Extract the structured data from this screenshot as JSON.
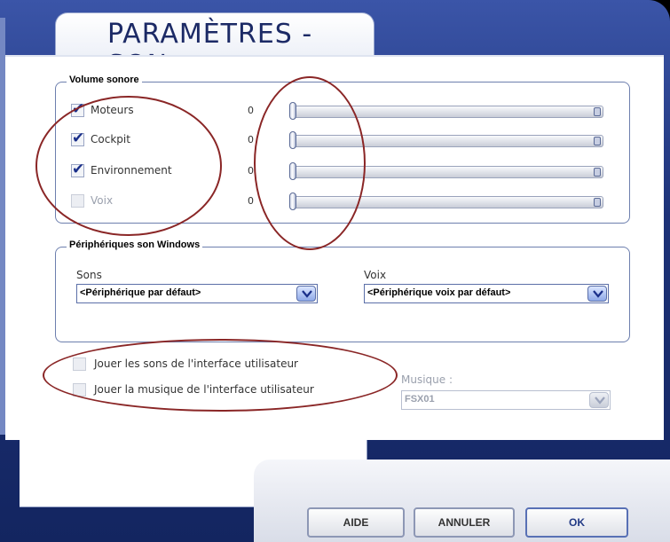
{
  "window": {
    "title": "PARAMÈTRES - SON"
  },
  "volume_group": {
    "legend": "Volume sonore",
    "rows": [
      {
        "label": "Moteurs",
        "checked": true,
        "value": "0",
        "level": 0
      },
      {
        "label": "Cockpit",
        "checked": true,
        "value": "0",
        "level": 0
      },
      {
        "label": "Environnement",
        "checked": true,
        "value": "0",
        "level": 0
      },
      {
        "label": "Voix",
        "checked": false,
        "value": "0",
        "level": 0
      }
    ]
  },
  "devices_group": {
    "legend": "Périphériques son Windows",
    "sons": {
      "label": "Sons",
      "value": "<Périphérique par défaut>"
    },
    "voix": {
      "label": "Voix",
      "value": "<Périphérique voix par défaut>"
    }
  },
  "ui_sounds": {
    "play_sounds_label": "Jouer les sons de l'interface utilisateur",
    "play_sounds_checked": false,
    "play_music_label": "Jouer la musique de l'interface utilisateur",
    "play_music_checked": false,
    "music": {
      "label": "Musique :",
      "value": "FSX01"
    }
  },
  "buttons": {
    "help": "AIDE",
    "cancel": "ANNULER",
    "ok": "OK"
  },
  "colors": {
    "frame": "#1d3278",
    "annotation": "#8a2626",
    "accent": "#223a85"
  }
}
